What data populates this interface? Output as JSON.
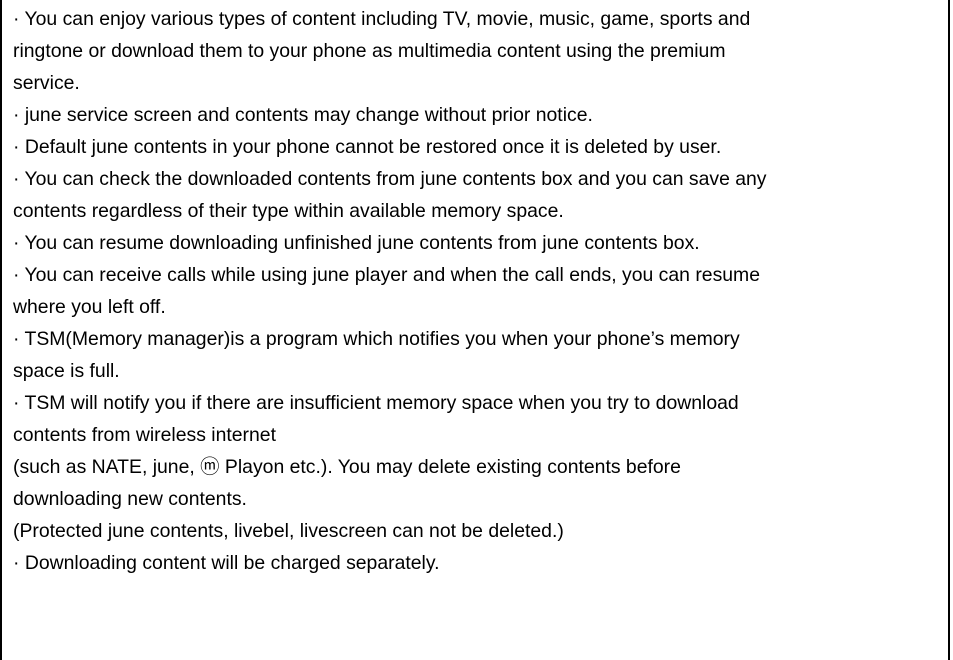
{
  "document": {
    "lines": [
      "· You can enjoy various types of content including TV, movie, music, game, sports and",
      "ringtone or download them to your phone as multimedia content using the premium",
      "service.",
      "· june service screen and contents may change without prior notice.",
      "· Default june contents in your phone cannot be restored once it is deleted by user.",
      "· You can check the downloaded contents from june contents box and you can save any",
      "contents regardless of their type within available memory space.",
      "· You can resume downloading unfinished june contents from june contents box.",
      "· You can receive calls while using june player and when the call ends, you can resume",
      "where you left off.",
      "· TSM(Memory manager)is a program which notifies you when your phone’s memory",
      "space is full.",
      "· TSM will notify you if there are insufficient memory space when you try to download",
      "contents from wireless internet",
      "(such as NATE, june, ⓜ Playon etc.). You may delete existing contents before",
      "downloading new contents.",
      "(Protected june contents, livebel, livescreen can not be deleted.)",
      "· Downloading content will be charged separately."
    ]
  }
}
